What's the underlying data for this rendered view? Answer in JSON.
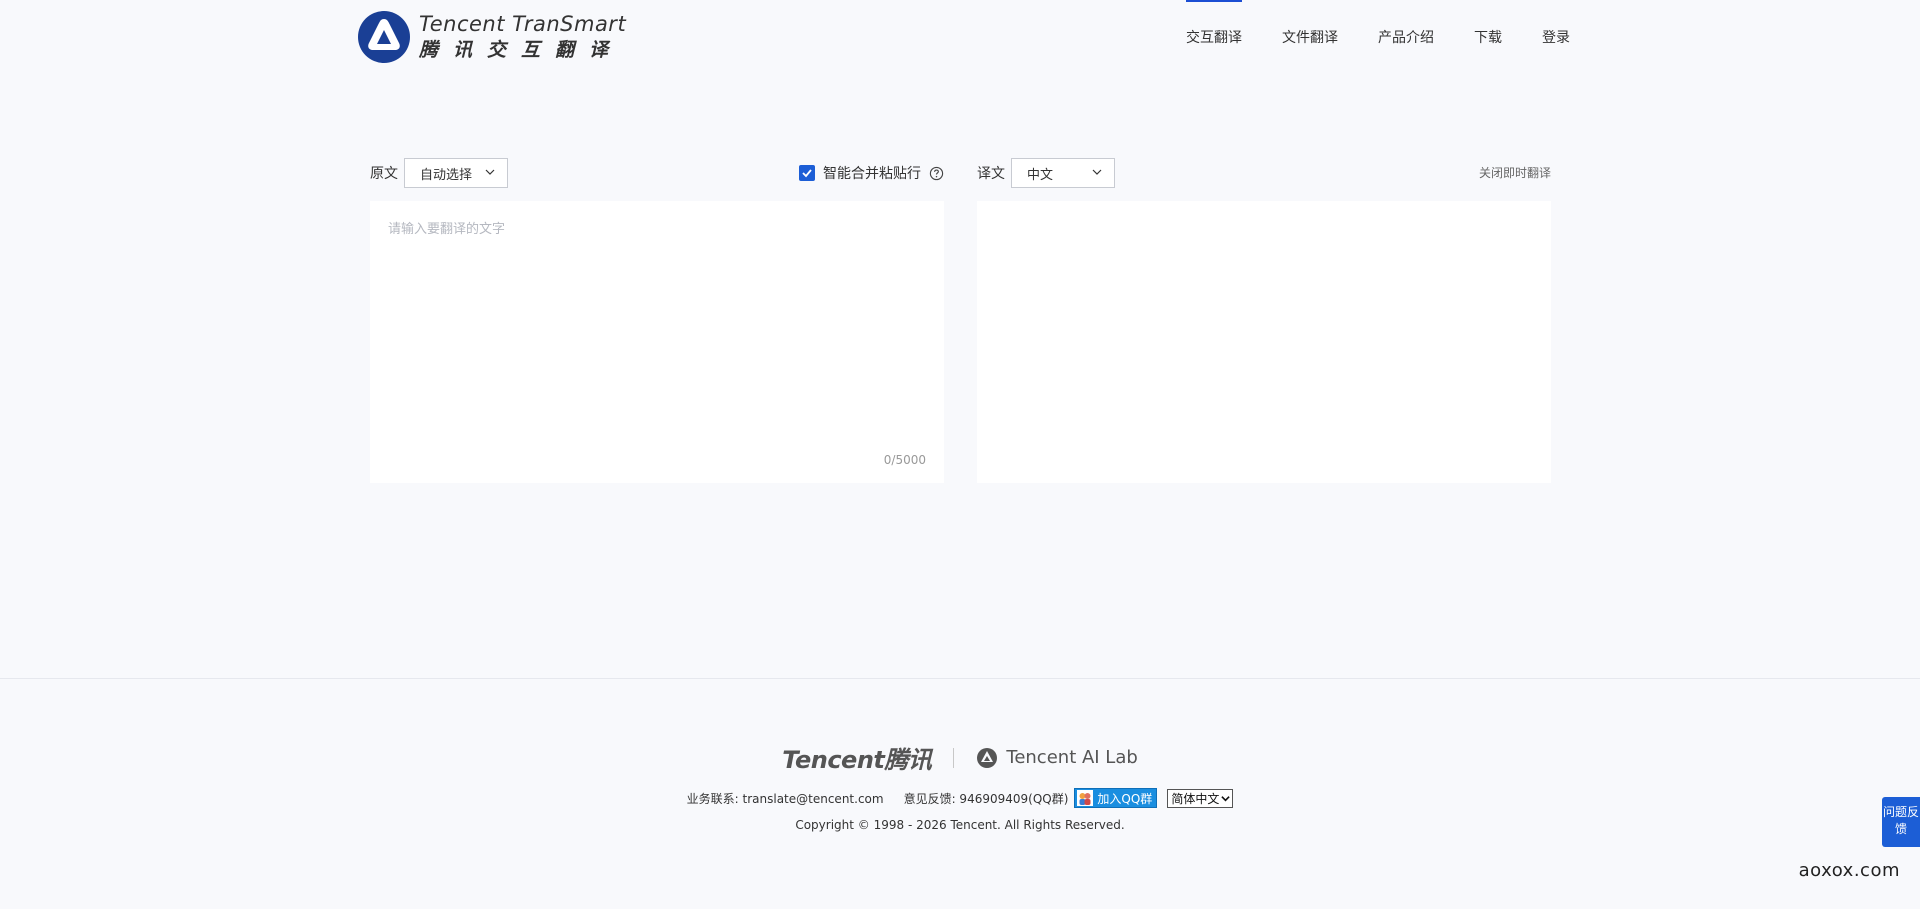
{
  "header": {
    "logo_en": "Tencent TranSmart",
    "logo_cn": "腾讯交互翻译",
    "nav": [
      {
        "label": "交互翻译",
        "active": true
      },
      {
        "label": "文件翻译",
        "active": false
      },
      {
        "label": "产品介绍",
        "active": false
      },
      {
        "label": "下载",
        "active": false
      },
      {
        "label": "登录",
        "active": false
      }
    ]
  },
  "source": {
    "label": "原文",
    "language": "自动选择",
    "merge_label": "智能合并粘贴行",
    "merge_checked": true,
    "placeholder": "请输入要翻译的文字",
    "counter": "0/5000"
  },
  "target": {
    "label": "译文",
    "language": "中文",
    "close_instant": "关闭即时翻译"
  },
  "footer": {
    "brand_tencent": "Tencent腾讯",
    "brand_ailab": "Tencent AI Lab",
    "contact": "业务联系: translate@tencent.com",
    "feedback": "意见反馈: 946909409(QQ群)",
    "qq_button": "加入QQ群",
    "language_picker": "简体中文",
    "copyright": "Copyright © 1998 - 2026 Tencent. All Rights Reserved."
  },
  "feedback_button": "问题反馈",
  "watermark": "aoxox.com",
  "colors": {
    "accent": "#1c5ed6",
    "background": "#f8f9fc",
    "qq_blue": "#1a8ee0"
  }
}
